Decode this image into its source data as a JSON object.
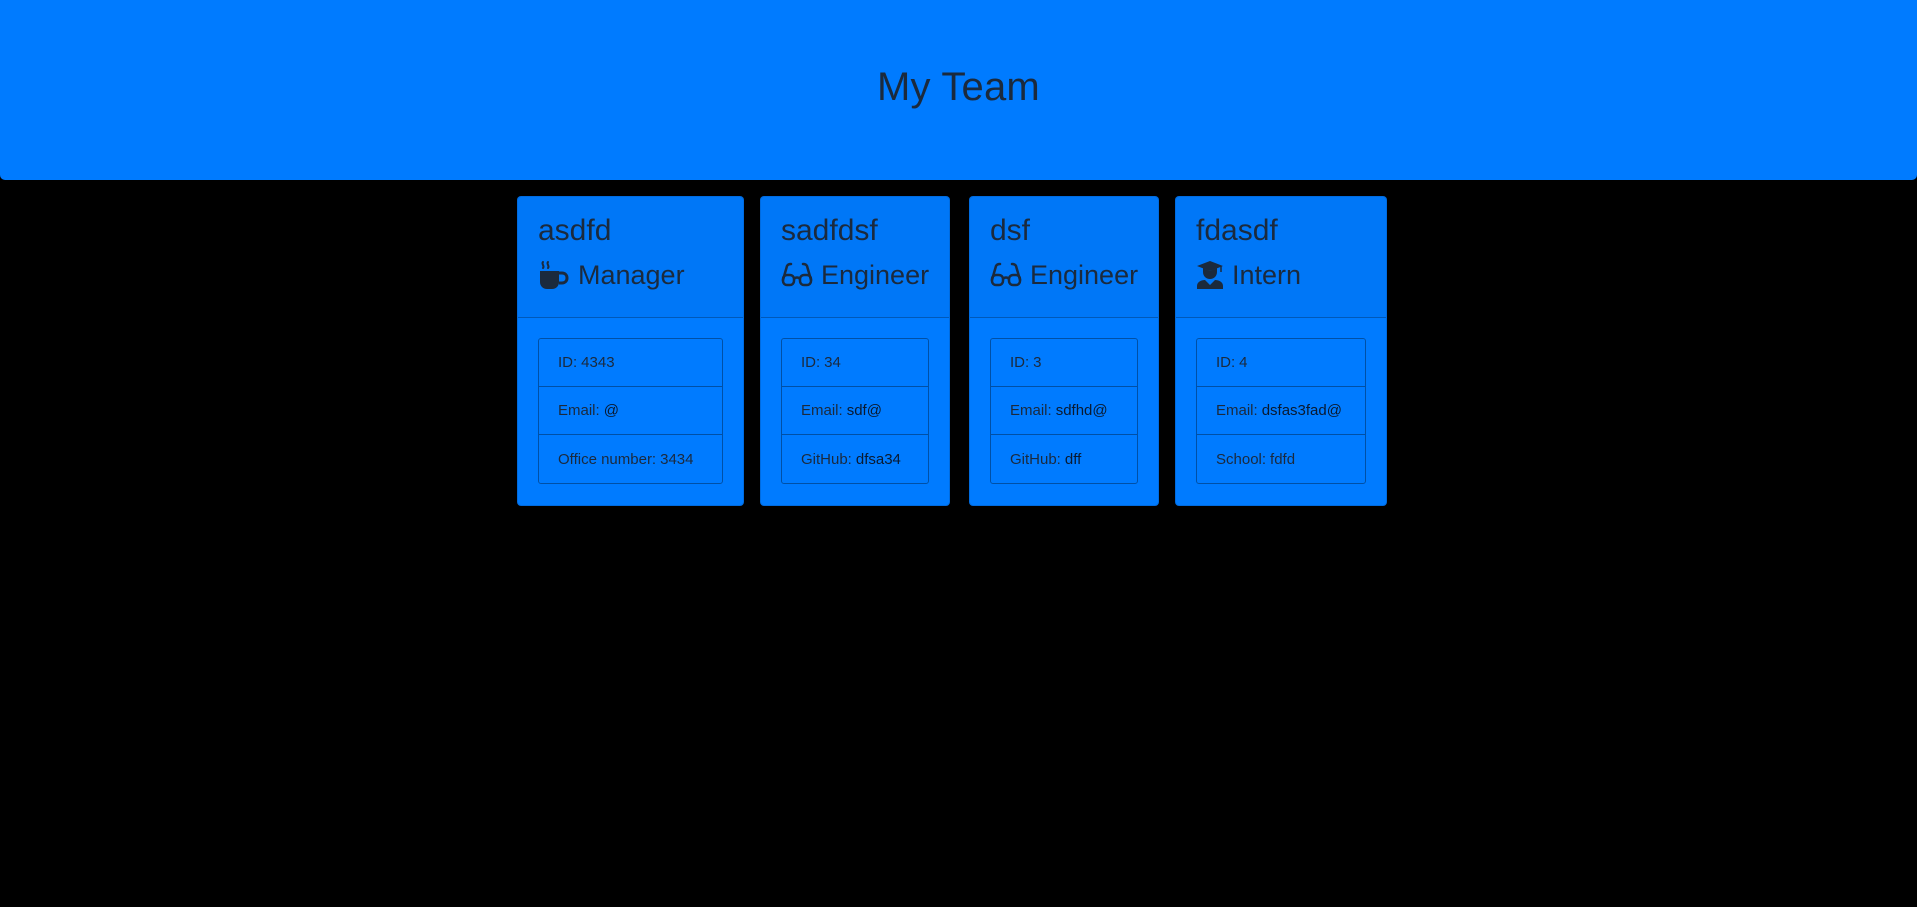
{
  "header": {
    "title": "My Team"
  },
  "cards": [
    {
      "name": "asdfd",
      "role": "Manager",
      "icon": "mug-icon",
      "id_label": "ID:",
      "id_value": "4343",
      "email_label": "Email:",
      "email_value": "@",
      "extra_label": "Office number:",
      "extra_value": "3434"
    },
    {
      "name": "sadfdsf",
      "role": "Engineer",
      "icon": "glasses-icon",
      "id_label": "ID:",
      "id_value": "34",
      "email_label": "Email:",
      "email_value": "sdf@",
      "extra_label": "GitHub:",
      "extra_value": "dfsa34"
    },
    {
      "name": "dsf",
      "role": "Engineer",
      "icon": "glasses-icon",
      "id_label": "ID:",
      "id_value": "3",
      "email_label": "Email:",
      "email_value": "sdfhd@",
      "extra_label": "GitHub:",
      "extra_value": "dff"
    },
    {
      "name": "fdasdf",
      "role": "Intern",
      "icon": "graduate-icon",
      "id_label": "ID:",
      "id_value": "4",
      "email_label": "Email:",
      "email_value": "dsfas3fad@",
      "extra_label": "School:",
      "extra_value": "fdfd"
    }
  ],
  "colors": {
    "accent": "#007bff",
    "background": "#000000",
    "text": "#1b2a3d"
  }
}
